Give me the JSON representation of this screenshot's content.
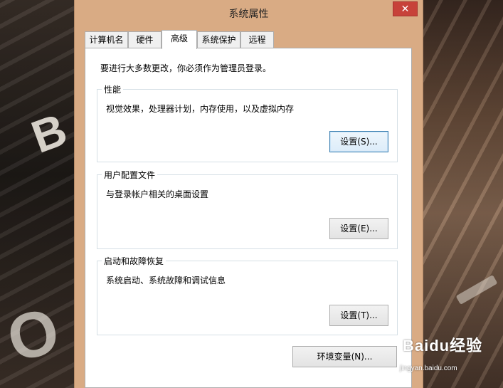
{
  "window": {
    "title": "系统属性",
    "close_glyph": "✕"
  },
  "tabs": [
    {
      "label": "计算机名"
    },
    {
      "label": "硬件"
    },
    {
      "label": "高级",
      "active": true
    },
    {
      "label": "系统保护"
    },
    {
      "label": "远程"
    }
  ],
  "panel": {
    "admin_note": "要进行大多数更改，你必须作为管理员登录。",
    "performance": {
      "title": "性能",
      "description": "视觉效果，处理器计划，内存使用，以及虚拟内存",
      "button": "设置(S)..."
    },
    "user_profiles": {
      "title": "用户配置文件",
      "description": "与登录帐户相关的桌面设置",
      "button": "设置(E)..."
    },
    "startup_recovery": {
      "title": "启动和故障恢复",
      "description": "系统启动、系统故障和调试信息",
      "button": "设置(T)..."
    },
    "env_button": "环境变量(N)..."
  },
  "watermark": {
    "brand": "Baidu经验",
    "url": "jingyan.baidu.com"
  },
  "colors": {
    "title_bar": "#d9ab84",
    "close_button": "#c7423a",
    "focus_border": "#3c7fb1"
  }
}
